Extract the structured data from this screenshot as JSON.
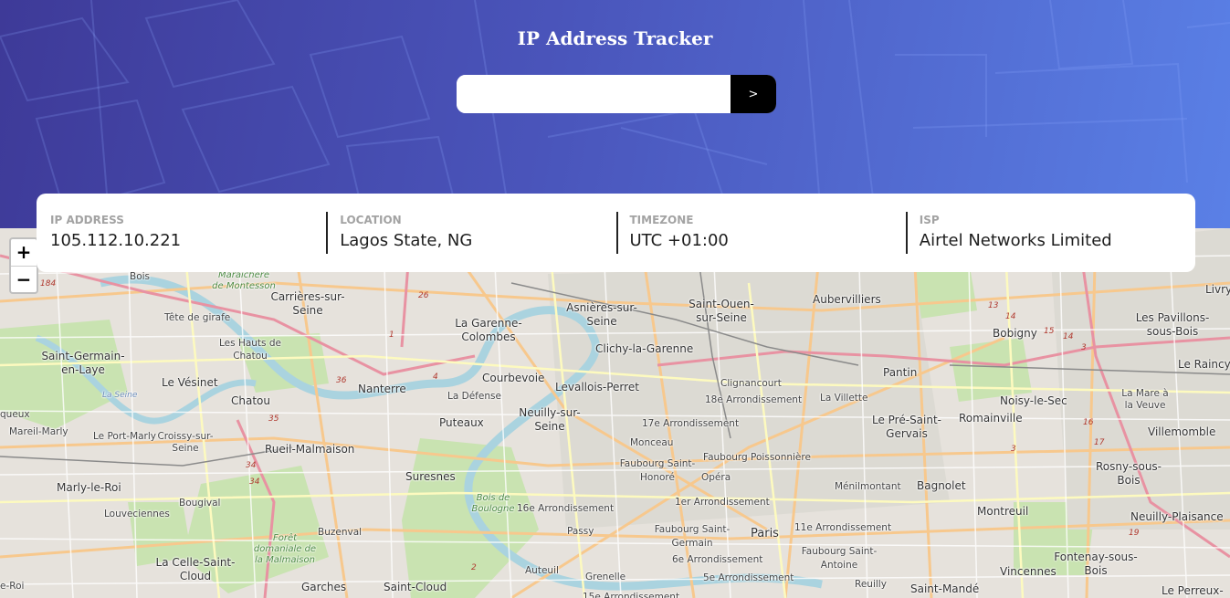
{
  "header": {
    "title": "IP Address Tracker",
    "search_placeholder": "",
    "search_value": "",
    "submit_label": ">",
    "gradient_colors": [
      "#3e3a98",
      "#5a80e6"
    ]
  },
  "info": {
    "ip_label": "IP ADDRESS",
    "ip_value": "105.112.10.221",
    "location_label": "LOCATION",
    "location_value": "Lagos State, NG",
    "timezone_label": "TIMEZONE",
    "timezone_value": "UTC +01:00",
    "isp_label": "ISP",
    "isp_value": "Airtel Networks Limited"
  },
  "map": {
    "zoom_in": "+",
    "zoom_out": "−",
    "places": {
      "bois": "Bois",
      "maraichere": "Maraîchère de Montesson",
      "carrieres": "Carrières-sur-Seine",
      "tete_girafe": "Tête de girafe",
      "hauts_chatou": "Les Hauts de Chatou",
      "saint_germain": "Saint-Germain-en-Laye",
      "le_vesinet": "Le Vésinet",
      "chatou": "Chatou",
      "la_seine": "La Seine",
      "mareil": "Mareil-Marly",
      "port_marly": "Le Port-Marly",
      "croissy": "Croissy-sur-Seine",
      "rueil": "Rueil-Malmaison",
      "marly_roi": "Marly-le-Roi",
      "bougival": "Bougival",
      "louveciennes": "Louveciennes",
      "foret_malmaison": "Forêt domaniale de la Malmaison",
      "buzenval": "Buzenval",
      "celle_cloud": "La Celle-Saint-Cloud",
      "le_roi": "e-Roi",
      "garches": "Garches",
      "saint_cloud": "Saint-Cloud",
      "queux": "queux",
      "la_garenne": "La Garenne-Colombes",
      "nanterre": "Nanterre",
      "courbevoie": "Courbevoie",
      "la_defense": "La Défense",
      "puteaux": "Puteaux",
      "suresnes": "Suresnes",
      "bois_boulogne": "Bois de Boulogne",
      "asnieres": "Asnières-sur-Seine",
      "clichy": "Clichy-la-Garenne",
      "levallois": "Levallois-Perret",
      "neuilly": "Neuilly-sur-Seine",
      "arr17": "17e Arrondissement",
      "monceau": "Monceau",
      "fbg_honore": "Faubourg Saint-Honoré",
      "arr16": "16e Arrondissement",
      "passy": "Passy",
      "auteuil": "Auteuil",
      "grenelle": "Grenelle",
      "arr15": "15e Arrondissement",
      "saint_ouen": "Saint-Ouen-sur-Seine",
      "clignancourt": "Clignancourt",
      "arr18": "18e Arrondissement",
      "la_villette": "La Villette",
      "fbg_poissonniere": "Faubourg Poissonnière",
      "opera": "Opéra",
      "arr1": "1er Arrondissement",
      "paris": "Paris",
      "fbg_germain": "Faubourg Saint-Germain",
      "arr6": "6e Arrondissement",
      "arr5": "5e Arrondissement",
      "aubervilliers": "Aubervilliers",
      "pantin": "Pantin",
      "pre_gervais": "Le Pré-Saint-Gervais",
      "menilmontant": "Ménilmontant",
      "arr11": "11e Arrondissement",
      "fbg_antoine": "Faubourg Saint-Antoine",
      "reuilly": "Reuilly",
      "bagnolet": "Bagnolet",
      "montreuil": "Montreuil",
      "saint_mande": "Saint-Mandé",
      "vincennes": "Vincennes",
      "bobigny": "Bobigny",
      "romainville": "Romainville",
      "noisy_sec": "Noisy-le-Sec",
      "villemomble": "Villemomble",
      "pavillons": "Les Pavillons-sous-Bois",
      "livry": "Livry",
      "le_raincy": "Le Raincy",
      "la_mare": "La Mare à la Veuve",
      "rosny": "Rosny-sous-Bois",
      "neuilly_plaisance": "Neuilly-Plaisance",
      "fontenay": "Fontenay-sous-Bois",
      "le_perreux": "Le Perreux-"
    },
    "road_numbers": [
      "184",
      "26",
      "1",
      "4",
      "36",
      "35",
      "34",
      "34",
      "13",
      "14",
      "15",
      "14",
      "3",
      "3",
      "16",
      "17",
      "19",
      "2"
    ]
  }
}
